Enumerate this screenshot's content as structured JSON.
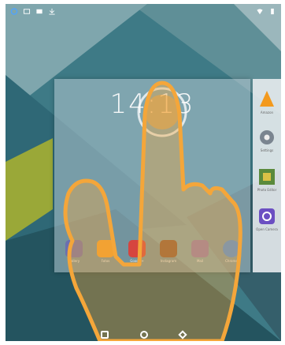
{
  "status_bar": {
    "left_icons": [
      "sync-icon",
      "image-icon",
      "image-icon",
      "download-icon"
    ],
    "right_icons": [
      "wifi-icon",
      "battery-icon"
    ]
  },
  "overview": {
    "clock": "14:13",
    "dock_apps": [
      {
        "icon": "app-icon",
        "label": "Gallery",
        "color": "#6b6fb0"
      },
      {
        "icon": "photos-icon",
        "label": "Fotos",
        "color": "#f0a030"
      },
      {
        "icon": "google-plus-icon",
        "label": "Google+",
        "color": "#d6453f"
      },
      {
        "icon": "instagram-icon",
        "label": "Instagram",
        "color": "#8a5a3a"
      },
      {
        "icon": "mail-icon",
        "label": "Mail",
        "color": "#8e7bb0"
      },
      {
        "icon": "chrome-icon",
        "label": "Chrome",
        "color": "#4a8fe0"
      }
    ]
  },
  "right_panel": {
    "apps": [
      {
        "icon": "vlc-icon",
        "label": "Amazon",
        "color": "#f39a1e"
      },
      {
        "icon": "settings-icon",
        "label": "Settings",
        "color": "#7a8590"
      },
      {
        "icon": "photo-editor-icon",
        "label": "Photo Editor",
        "color": "#5a8a3c"
      },
      {
        "icon": "camera-icon",
        "label": "Open Camera",
        "color": "#6b4fc2"
      }
    ]
  },
  "nav_bar": {
    "buttons": [
      "recents-button",
      "home-button",
      "back-button"
    ]
  },
  "colors": {
    "wallpaper_base": "#3e7a86",
    "accent_orange": "#f4a63a"
  }
}
